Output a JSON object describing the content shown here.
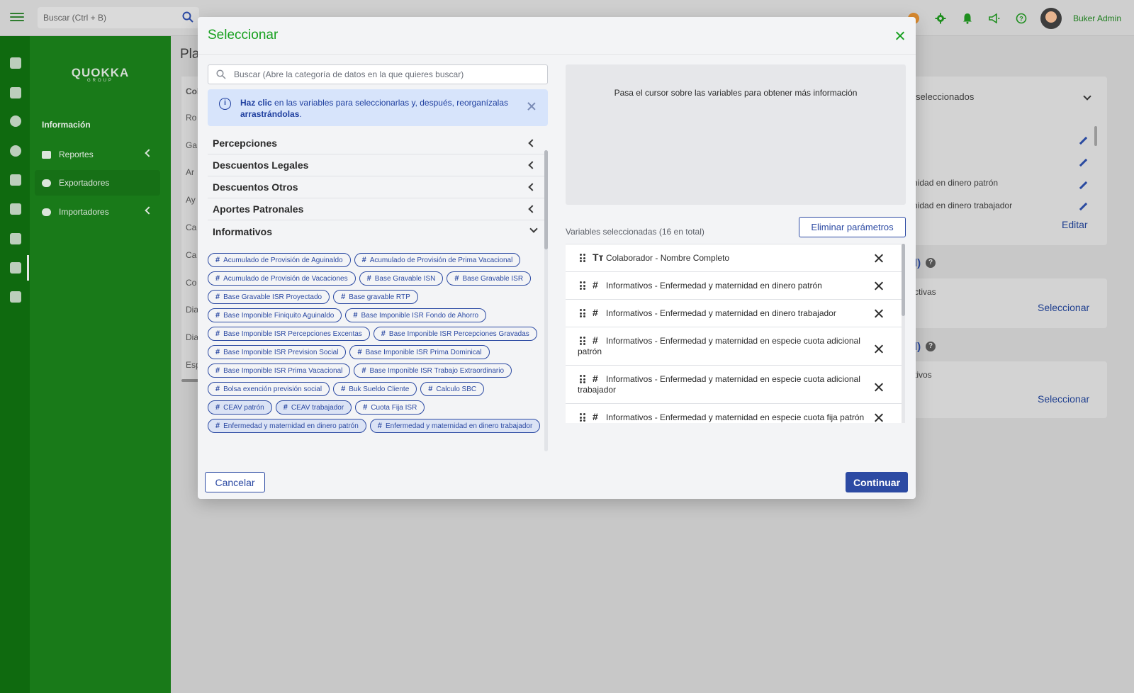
{
  "header": {
    "search_placeholder": "Buscar (Ctrl + B)",
    "user_name": "Buker Admin"
  },
  "sidebar": {
    "logo": "QUOKKA",
    "logo_sub": "GROUP",
    "section_title": "Información",
    "items": [
      {
        "label": "Reportes",
        "icon": "bar-chart-icon"
      },
      {
        "label": "Exportadores",
        "icon": "cloud-upload-icon",
        "active": true
      },
      {
        "label": "Importadores",
        "icon": "cloud-download-icon"
      }
    ]
  },
  "background": {
    "page_title": "Pla",
    "table_rows": [
      "Col",
      "Ro",
      "Ga",
      "Ar",
      "Ay",
      "Ca",
      "Ca",
      "Co",
      "Dia",
      "Dia",
      "Esp"
    ],
    "right_panel": {
      "header": "seleccionados",
      "item1": "nidad en dinero patrón",
      "item2": "nidad en dinero trabajador",
      "edit_link": "Editar",
      "section2_suffix": "l)",
      "section2_text": "ctivas",
      "section2_link": "Seleccionar",
      "section3_suffix": "l)",
      "section3_text": "tivos",
      "section3_link": "Seleccionar"
    }
  },
  "modal": {
    "title": "Seleccionar",
    "search_placeholder": "Buscar (Abre la categoría de datos en la que quieres buscar)",
    "info": {
      "bold1": "Haz clic",
      "text1": " en las variables para seleccionarlas y, después, reorganízalas ",
      "bold2": "arrastrándolas",
      "text2": "."
    },
    "categories": [
      {
        "label": "Percepciones",
        "open": false
      },
      {
        "label": "Descuentos Legales",
        "open": false
      },
      {
        "label": "Descuentos Otros",
        "open": false
      },
      {
        "label": "Aportes Patronales",
        "open": false
      },
      {
        "label": "Informativos",
        "open": true
      }
    ],
    "chips": [
      {
        "label": "Acumulado de Provisión de Aguinaldo",
        "selected": false
      },
      {
        "label": "Acumulado de Provisión de Prima Vacacional",
        "selected": false
      },
      {
        "label": "Acumulado de Provisión de Vacaciones",
        "selected": false
      },
      {
        "label": "Base Gravable ISN",
        "selected": false
      },
      {
        "label": "Base Gravable ISR",
        "selected": false
      },
      {
        "label": "Base Gravable ISR Proyectado",
        "selected": false
      },
      {
        "label": "Base gravable RTP",
        "selected": false
      },
      {
        "label": "Base Imponible Finiquito Aguinaldo",
        "selected": false
      },
      {
        "label": "Base Imponible ISR Fondo de Ahorro",
        "selected": false
      },
      {
        "label": "Base Imponible ISR Percepciones Excentas",
        "selected": false
      },
      {
        "label": "Base Imponible ISR Percepciones Gravadas",
        "selected": false
      },
      {
        "label": "Base Imponible ISR Prevision Social",
        "selected": false
      },
      {
        "label": "Base Imponible ISR Prima Dominical",
        "selected": false
      },
      {
        "label": "Base Imponible ISR Prima Vacacional",
        "selected": false
      },
      {
        "label": "Base Imponible ISR Trabajo Extraordinario",
        "selected": false
      },
      {
        "label": "Bolsa exención previsión social",
        "selected": false
      },
      {
        "label": "Buk Sueldo Cliente",
        "selected": false
      },
      {
        "label": "Calculo SBC",
        "selected": false
      },
      {
        "label": "CEAV patrón",
        "selected": true
      },
      {
        "label": "CEAV trabajador",
        "selected": true
      },
      {
        "label": "Cuota Fija ISR",
        "selected": false
      },
      {
        "label": "Enfermedad y maternidad en dinero patrón",
        "selected": true
      },
      {
        "label": "Enfermedad y maternidad en dinero trabajador",
        "selected": true
      }
    ],
    "hover_hint": "Pasa el cursor sobre las variables para obtener más información",
    "selected_label": "Variables seleccionadas (16 en total)",
    "clear_button": "Eliminar parámetros",
    "selected_items": [
      {
        "type": "text",
        "type_glyph": "Tт",
        "label": "Colaborador - Nombre Completo",
        "wrap": false
      },
      {
        "type": "number",
        "type_glyph": "#",
        "label": "Informativos - Enfermedad y maternidad en dinero patrón",
        "wrap": false
      },
      {
        "type": "number",
        "type_glyph": "#",
        "label": "Informativos - Enfermedad y maternidad en dinero trabajador",
        "wrap": false
      },
      {
        "type": "number",
        "type_glyph": "#",
        "label": "Informativos - Enfermedad y maternidad en especie cuota adicional patrón",
        "wrap": true
      },
      {
        "type": "number",
        "type_glyph": "#",
        "label": "Informativos - Enfermedad y maternidad en especie cuota adicional trabajador",
        "wrap": true
      },
      {
        "type": "number",
        "type_glyph": "#",
        "label": "Informativos - Enfermedad y maternidad en especie cuota fija patrón",
        "wrap": false
      }
    ],
    "cancel_button": "Cancelar",
    "continue_button": "Continuar"
  },
  "colors": {
    "brand_green": "#17a01f",
    "primary_blue": "#2c4aa3",
    "sidebar_green": "#197a19"
  }
}
